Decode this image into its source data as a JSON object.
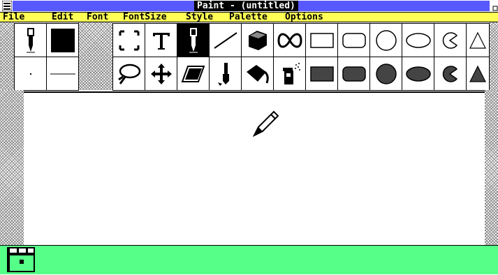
{
  "window": {
    "title": "Paint - (untitled)"
  },
  "menu": [
    "File",
    "Edit",
    "Font",
    "FontSize",
    "Style",
    "Palette",
    "Options"
  ],
  "colors": {
    "title_bar": "#5858ff",
    "menu_bar": "#ffff55",
    "palette_bar": "#55ff88",
    "selection": "#000000"
  },
  "tools": {
    "row1": [
      "pencil",
      "filled-square",
      "selection-rectangle",
      "text",
      "brush-selected",
      "line",
      "3d-cube",
      "curve",
      "rectangle",
      "rounded-rectangle",
      "circle",
      "ellipse",
      "pie",
      "triangle"
    ],
    "row2": [
      "dot-width",
      "line-width",
      "lasso",
      "move",
      "eraser",
      "paint-brush",
      "paint-bucket",
      "spray-can",
      "filled-rectangle",
      "filled-rounded-rectangle",
      "filled-circle",
      "filled-ellipse",
      "filled-pie",
      "filled-triangle"
    ],
    "selected": "brush"
  }
}
